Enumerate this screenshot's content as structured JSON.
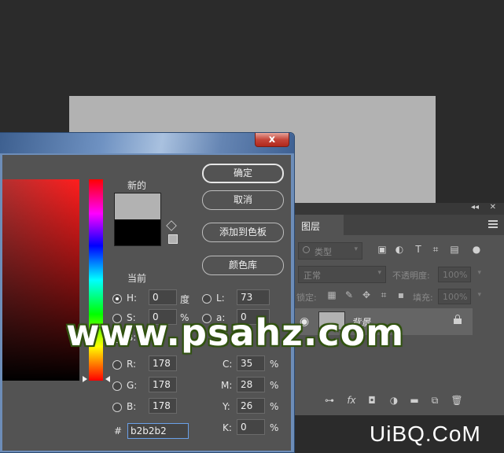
{
  "layers_panel": {
    "collapse_glyph": "◂◂",
    "close_glyph": "✕",
    "tab_label": "图层",
    "filter_kind": "类型",
    "filter_icons": [
      "image-filter-icon",
      "adjustment-filter-icon",
      "type-filter-icon",
      "shape-filter-icon",
      "smart-object-filter-icon"
    ],
    "blend_mode": "正常",
    "opacity_label": "不透明度:",
    "opacity_value": "100%",
    "lock_label": "锁定:",
    "fill_label": "填充:",
    "fill_value": "100%",
    "layer_name": "背景",
    "bottom_icons": [
      "link-icon",
      "fx-icon",
      "mask-icon",
      "adjustment-icon",
      "folder-icon",
      "new-layer-icon",
      "trash-icon"
    ]
  },
  "dialog": {
    "close_label": "x",
    "new_label": "新的",
    "current_label": "当前",
    "new_color": "#b2b2b2",
    "current_color": "#000000",
    "ok_label": "确定",
    "cancel_label": "取消",
    "add_swatch_label": "添加到色板",
    "libraries_label": "颜色库",
    "hsb": {
      "h_label": "H:",
      "h_value": "0",
      "h_unit": "度",
      "s_label": "S:",
      "s_value": "0",
      "s_unit": "%",
      "b_label": "B:"
    },
    "lab": {
      "l_label": "L:",
      "l_value": "73",
      "a_label": "a:",
      "a_value": "0"
    },
    "rgb": {
      "r_label": "R:",
      "r_value": "178",
      "g_label": "G:",
      "g_value": "178",
      "b_label": "B:",
      "b_value": "178"
    },
    "cmyk": {
      "c_label": "C:",
      "c_value": "35",
      "m_label": "M:",
      "m_value": "28",
      "y_label": "Y:",
      "y_value": "26",
      "k_label": "K:",
      "k_value": "0",
      "unit": "%"
    },
    "hex_label": "#",
    "hex_value": "b2b2b2"
  },
  "watermarks": {
    "psahz": "www.psahz.com",
    "uibq": "UiBQ.CoM"
  },
  "colors": {
    "canvas": "#b2b2b2",
    "workspace": "#2b2b2b",
    "panel": "#535353"
  }
}
